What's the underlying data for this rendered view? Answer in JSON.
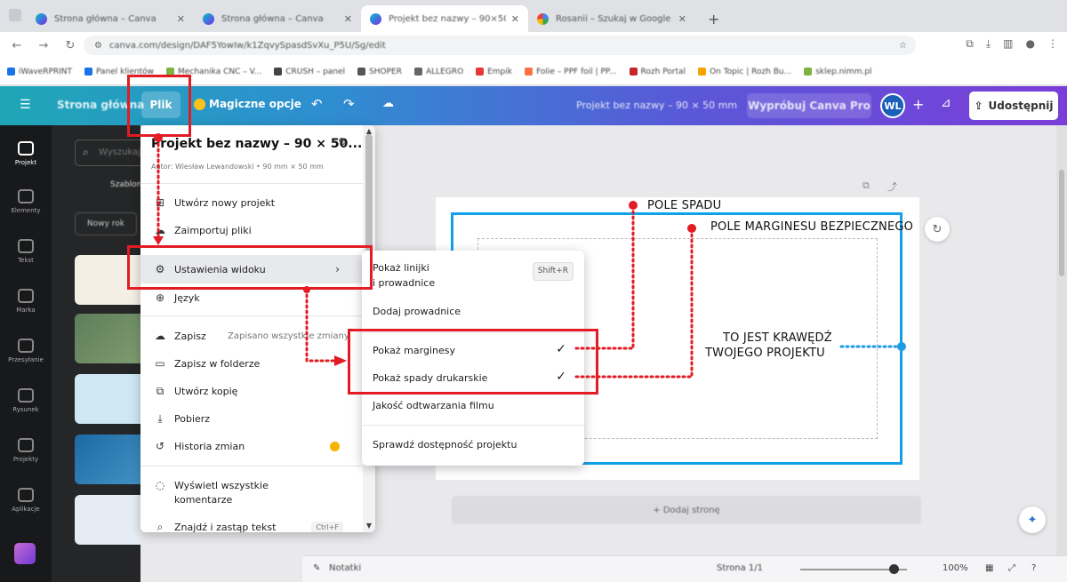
{
  "browser": {
    "tabs": [
      {
        "title": "Strona główna – Canva",
        "active": false
      },
      {
        "title": "Strona główna – Canva",
        "active": false
      },
      {
        "title": "Projekt bez nazwy – 90×50 mm",
        "active": true
      },
      {
        "title": "Rosanii – Szukaj w Google",
        "active": false
      }
    ],
    "url": "canva.com/design/DAF5YowIw/k1ZqvySpasdSvXu_P5U/Sg/edit",
    "bookmarks": [
      "iWaveRPRINT",
      "Panel klientów",
      "Mechanika CNC – V...",
      "CRUSH – panel",
      "SHOPER",
      "ALLEGRO",
      "Empik",
      "Folie – PPF foil | PP...",
      "Rozh Portal",
      "On Topic | Rozh Bu...",
      "sklep.nimm.pl"
    ],
    "bookmark_colors": [
      "#1a73e8",
      "#1a73e8",
      "#7cb342",
      "#444444",
      "#555555",
      "#666666",
      "#e53935",
      "#ff7043",
      "#c62828",
      "#f4a300",
      "#7cb342"
    ]
  },
  "header": {
    "home": "Strona główna",
    "file": "Plik",
    "magic": "Magiczne opcje",
    "doc_title": "Projekt bez nazwy – 90 × 50 mm",
    "try_pro": "Wypróbuj Canva Pro",
    "avatar": "WL",
    "share": "Udostępnij"
  },
  "rail": [
    "Projekt",
    "Elementy",
    "Tekst",
    "Marka",
    "Przesyłanie",
    "Rysunek",
    "Projekty",
    "Aplikacje"
  ],
  "panel": {
    "search_placeholder": "Wyszukaj",
    "tab": "Szablony",
    "chip": "Nowy rok"
  },
  "file_menu": {
    "title": "Projekt bez nazwy – 90 × 50...",
    "author": "Autor: Wiesław Lewandowski • 90 mm × 50 mm",
    "items": [
      {
        "label": "Utwórz nowy projekt"
      },
      {
        "label": "Zaimportuj pliki"
      },
      {
        "label": "Ustawienia widoku"
      },
      {
        "label": "Język"
      },
      {
        "label": "Zapisz",
        "meta": "Zapisano wszystkie zmiany"
      },
      {
        "label": "Zapisz w folderze"
      },
      {
        "label": "Utwórz kopię"
      },
      {
        "label": "Pobierz"
      },
      {
        "label": "Historia zmian"
      },
      {
        "label": "Wyświetl wszystkie komentarze"
      },
      {
        "label": "Znajdź i zastąp tekst",
        "shortcut": "Ctrl+F"
      }
    ]
  },
  "submenu": {
    "items": [
      {
        "label": "Pokaż linijki i prowadnice",
        "shortcut": "Shift+R"
      },
      {
        "label": "Dodaj prowadnice"
      },
      {
        "label": "Pokaż marginesy",
        "checked": true
      },
      {
        "label": "Pokaż spady drukarskie",
        "checked": true
      },
      {
        "label": "Jakość odtwarzania filmu"
      },
      {
        "label": "Sprawdź dostępność projektu"
      }
    ],
    "line1": "Pokaż linijki",
    "line2": "i prowadnice"
  },
  "canvas": {
    "add_page": "+ Dodaj stronę"
  },
  "bottom": {
    "notes": "Notatki",
    "page": "Strona 1/1",
    "zoom": "100%"
  },
  "annotations": {
    "bleed": "POLE SPADU",
    "safe_margin": "POLE MARGINESU BEZPIECZNEGO",
    "edge_line1": "TO JEST KRAWĘDŹ",
    "edge_line2": "TWOJEGO PROJEKTU"
  },
  "colors": {
    "annotation_red": "#e21b24",
    "bleed_blue": "#14a0e8",
    "edge_dots": "#1e9be6"
  }
}
